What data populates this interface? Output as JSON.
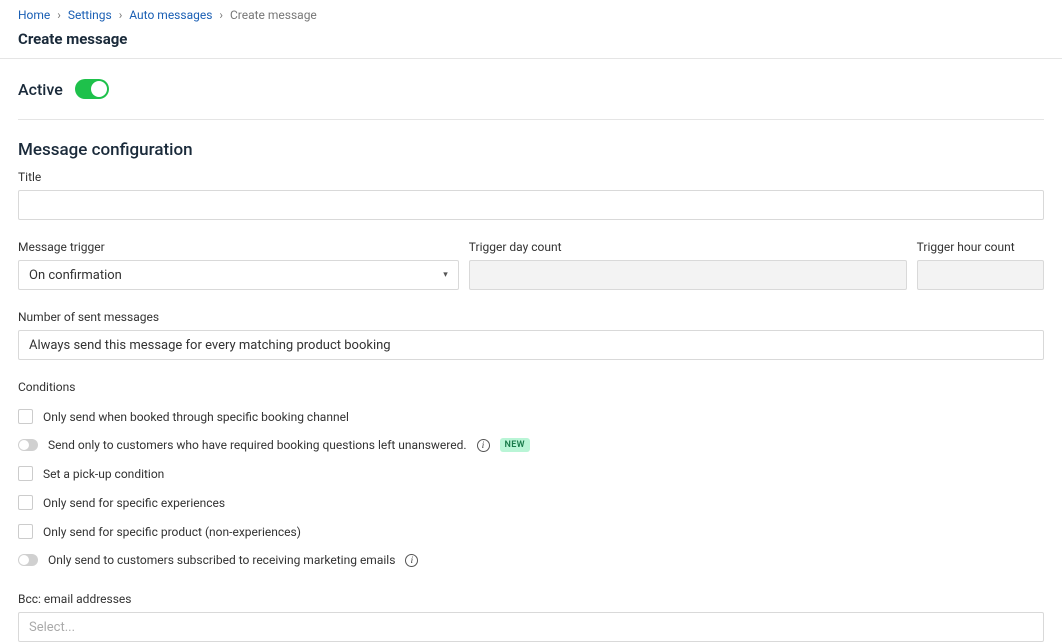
{
  "breadcrumb": {
    "items": [
      "Home",
      "Settings",
      "Auto messages"
    ],
    "current": "Create message"
  },
  "page_title": "Create message",
  "active": {
    "label": "Active",
    "value": true
  },
  "section": {
    "title": "Message configuration",
    "title_label": "Title",
    "title_value": "",
    "trigger_label": "Message trigger",
    "trigger_value": "On confirmation",
    "day_label": "Trigger day count",
    "day_value": "",
    "hour_label": "Trigger hour count",
    "hour_value": "",
    "sent_label": "Number of sent messages",
    "sent_value": "Always send this message for every matching product booking"
  },
  "conditions": {
    "heading": "Conditions",
    "items": [
      {
        "type": "checkbox",
        "label": "Only send when booked through specific booking channel"
      },
      {
        "type": "toggle",
        "label": "Send only to customers who have required booking questions left unanswered.",
        "info": true,
        "new": true
      },
      {
        "type": "checkbox",
        "label": "Set a pick-up condition"
      },
      {
        "type": "checkbox",
        "label": "Only send for specific experiences"
      },
      {
        "type": "checkbox",
        "label": "Only send for specific product (non-experiences)"
      },
      {
        "type": "toggle",
        "label": "Only send to customers subscribed to receiving marketing emails",
        "info": true
      }
    ]
  },
  "bcc": {
    "label": "Bcc: email addresses",
    "placeholder": "Select..."
  },
  "badges": {
    "new": "NEW"
  }
}
